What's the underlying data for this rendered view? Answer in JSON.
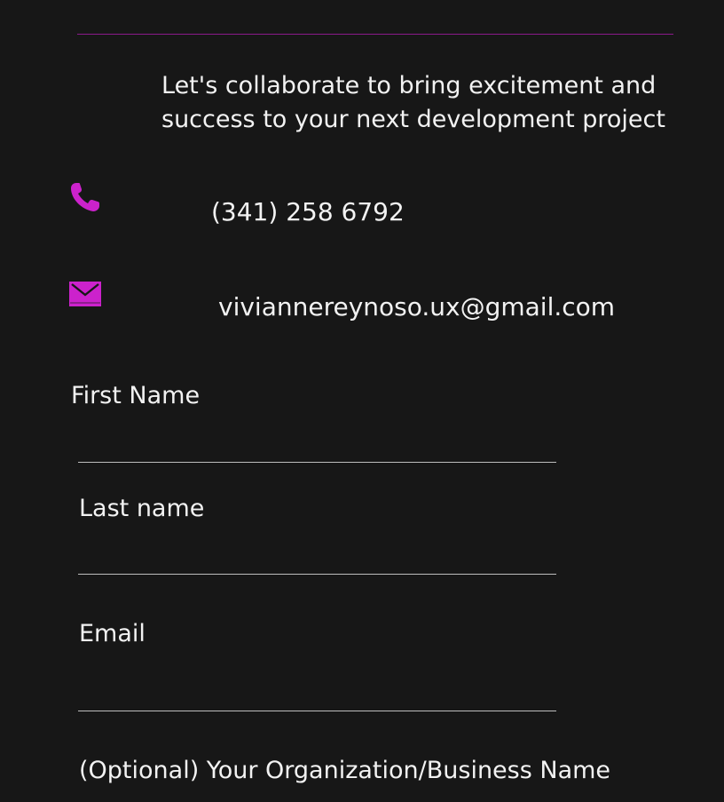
{
  "tagline": {
    "line1": "Let's collaborate to bring excitement and",
    "line2": "success to your next development project"
  },
  "contact": {
    "phone": "(341) 258 6792",
    "email": "viviannereynoso.ux@gmail.com",
    "phone_icon": "phone-icon",
    "mail_icon": "mail-icon"
  },
  "form": {
    "first_name": {
      "label": "First Name",
      "value": ""
    },
    "last_name": {
      "label": "Last name",
      "value": ""
    },
    "email": {
      "label": "Email",
      "value": ""
    },
    "organization": {
      "label": "(Optional) Your Organization/Business Name"
    }
  },
  "colors": {
    "background": "#171717",
    "accent": "#cc22cc",
    "rule": "#8b1a8b",
    "text": "#f2f2f2",
    "underline": "#bdbdbd"
  }
}
